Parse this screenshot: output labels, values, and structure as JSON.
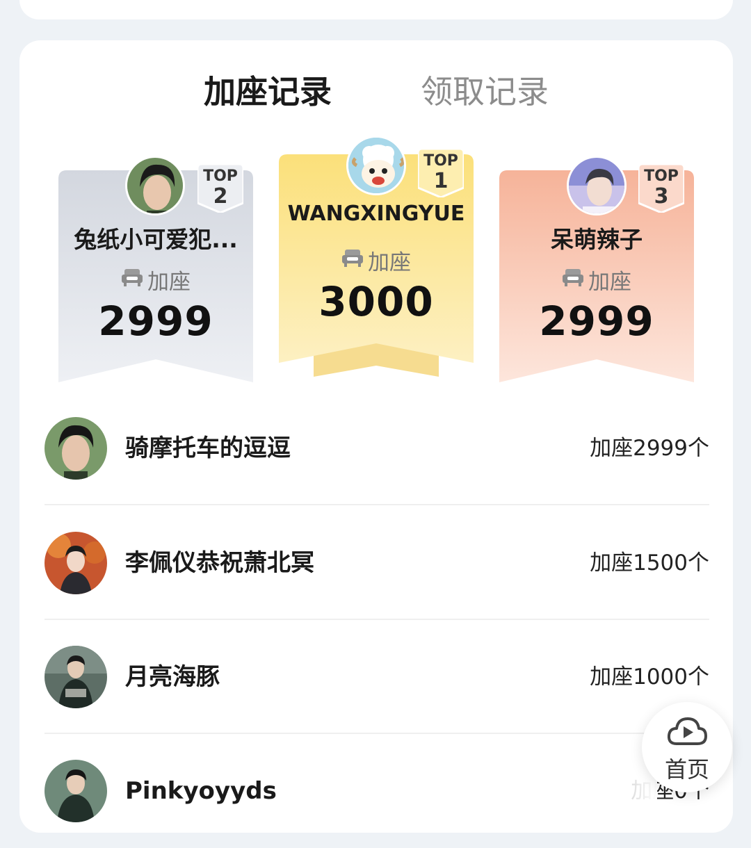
{
  "tabs": [
    {
      "label": "加座记录",
      "active": true
    },
    {
      "label": "领取记录",
      "active": false
    }
  ],
  "podium": {
    "first": {
      "badge_top": "TOP",
      "badge_rank": "1",
      "name": "WANGXINGYUE",
      "label": "加座",
      "count": "3000",
      "color": "#fbe58a"
    },
    "second": {
      "badge_top": "TOP",
      "badge_rank": "2",
      "name": "兔纸小可爱犯...",
      "label": "加座",
      "count": "2999",
      "color": "#d7dbe3"
    },
    "third": {
      "badge_top": "TOP",
      "badge_rank": "3",
      "name": "呆萌辣子",
      "label": "加座",
      "count": "2999",
      "color": "#f6b79f"
    }
  },
  "list": [
    {
      "name": "骑摩托车的逗逗",
      "count": "加座2999个"
    },
    {
      "name": "李佩仪恭祝萧北冥",
      "count": "加座1500个"
    },
    {
      "name": "月亮海豚",
      "count": "加座1000个"
    },
    {
      "name": "Pinkyoyyds",
      "count": "加座0个"
    }
  ],
  "float_button": {
    "icon": "cloud-play-icon",
    "label": "首页"
  }
}
